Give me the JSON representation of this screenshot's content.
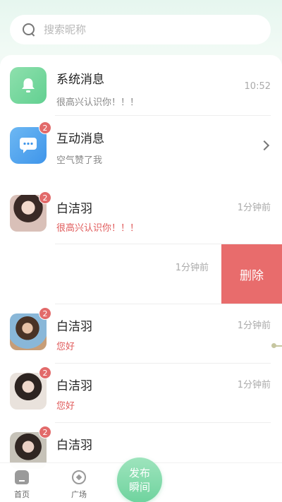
{
  "search": {
    "placeholder": "搜索昵称"
  },
  "system_msg": {
    "title": "系统消息",
    "subtitle": "很高兴认识你！！！",
    "time": "10:52"
  },
  "interact_msg": {
    "title": "互动消息",
    "subtitle": "空气赞了我",
    "badge": "2"
  },
  "chats": [
    {
      "name": "白洁羽",
      "preview": "很高兴认识你！！！",
      "time": "1分钟前",
      "badge": "2"
    },
    {
      "time": "1分钟前",
      "delete_label": "删除"
    },
    {
      "name": "白洁羽",
      "preview": "您好",
      "time": "1分钟前",
      "badge": "2"
    },
    {
      "name": "白洁羽",
      "preview": "您好",
      "time": "1分钟前",
      "badge": "2"
    },
    {
      "name": "白洁羽",
      "badge": "2"
    }
  ],
  "bottom_nav": {
    "home": "首页",
    "plaza": "广场",
    "publish_line1": "发布",
    "publish_line2": "瞬间"
  }
}
